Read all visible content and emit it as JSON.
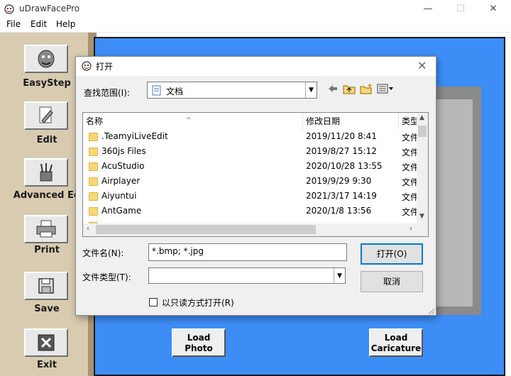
{
  "window": {
    "title": "uDrawFacePro",
    "minimize": "—",
    "maximize": "☐",
    "close": "✕"
  },
  "menu": [
    "File",
    "Edit",
    "Help"
  ],
  "toolbar": [
    {
      "label": "EasyStep",
      "icon": "face-icon"
    },
    {
      "label": "Edit",
      "icon": "edit-document-icon"
    },
    {
      "label": "Advanced Ed",
      "icon": "pencils-icon"
    },
    {
      "label": "Print",
      "icon": "printer-icon"
    },
    {
      "label": "Save",
      "icon": "floppy-disk-icon"
    },
    {
      "label": "Exit",
      "icon": "close-box-icon"
    }
  ],
  "canvas": {
    "load_photo": [
      "Load",
      "Photo"
    ],
    "load_caricature": [
      "Load",
      "Caricature"
    ]
  },
  "dialog": {
    "title": "打开",
    "look_in_label": "查找范围(I):",
    "look_in_value": "文档",
    "columns": {
      "name": "名称",
      "modified": "修改日期",
      "type": "类型"
    },
    "files": [
      {
        "name": ".TeamyiLiveEdit",
        "modified": "2019/11/20 8:41",
        "type": "文件"
      },
      {
        "name": "360js Files",
        "modified": "2019/8/27 15:12",
        "type": "文件"
      },
      {
        "name": "AcuStudio",
        "modified": "2020/10/28 13:55",
        "type": "文件"
      },
      {
        "name": "Airplayer",
        "modified": "2019/9/29 9:30",
        "type": "文件"
      },
      {
        "name": "Aiyuntui",
        "modified": "2021/3/17 14:19",
        "type": "文件"
      },
      {
        "name": "AntGame",
        "modified": "2020/1/8 13:56",
        "type": "文件"
      }
    ],
    "filename_label": "文件名(N):",
    "filename_value": "*.bmp; *.jpg",
    "filetype_label": "文件类型(T):",
    "filetype_value": "",
    "open_button": "打开(O)",
    "cancel_button": "取消",
    "readonly_label": "以只读方式打开(R)"
  },
  "colors": {
    "canvas_blue": "#3d8df6",
    "toolbar_tan": "#d8cbb0",
    "accent": "#0078d7"
  }
}
